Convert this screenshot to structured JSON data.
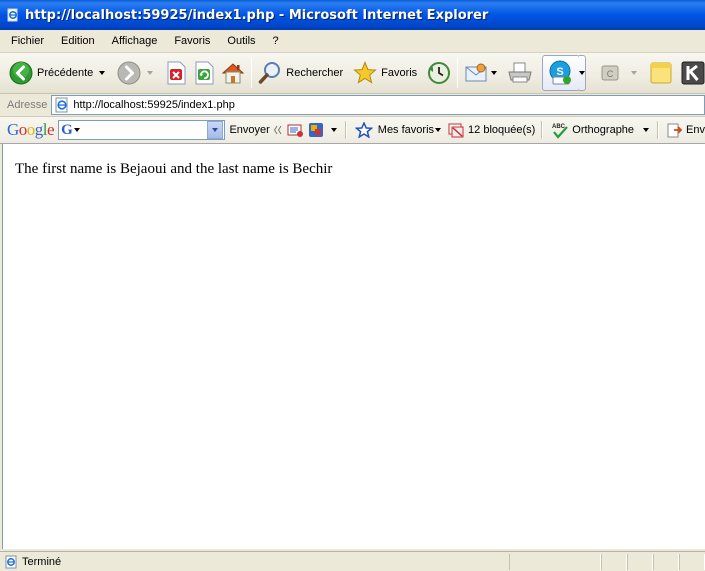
{
  "window": {
    "title": "http://localhost:59925/index1.php - Microsoft Internet Explorer"
  },
  "menu": {
    "items": [
      "Fichier",
      "Edition",
      "Affichage",
      "Favoris",
      "Outils",
      "?"
    ]
  },
  "toolbar": {
    "back_label": "Précédente",
    "search_label": "Rechercher",
    "favorites_label": "Favoris"
  },
  "address": {
    "label": "Adresse",
    "url": "http://localhost:59925/index1.php"
  },
  "google_toolbar": {
    "logo": "Google",
    "search_badge": "G",
    "send_label": "Envoyer",
    "bookmarks_label": "Mes favoris",
    "blocked_label": "12 bloquée(s)",
    "spellcheck_label": "Orthographe",
    "send_to_label": "Env"
  },
  "content": {
    "text": "The first name is Bejaoui and the last name is Bechir"
  },
  "status": {
    "text": "Terminé"
  },
  "colors": {
    "titlebar": "#0055e5",
    "chrome": "#ece9d8",
    "google_blue": "#3366cc",
    "google_red": "#cc3333",
    "google_yellow": "#e8b100",
    "google_green": "#2a9a3a"
  },
  "icons": {
    "title": "ie-page-icon",
    "back": "back-arrow-icon",
    "forward": "forward-arrow-icon",
    "stop": "stop-icon",
    "refresh": "refresh-icon",
    "home": "home-icon",
    "search": "search-magnifier-icon",
    "favorites": "favorites-star-icon",
    "history": "history-icon",
    "mail": "mail-icon",
    "print": "print-icon",
    "skype": "skype-icon",
    "messenger": "messenger-icon",
    "note": "note-icon",
    "extension": "k-extension-icon"
  }
}
